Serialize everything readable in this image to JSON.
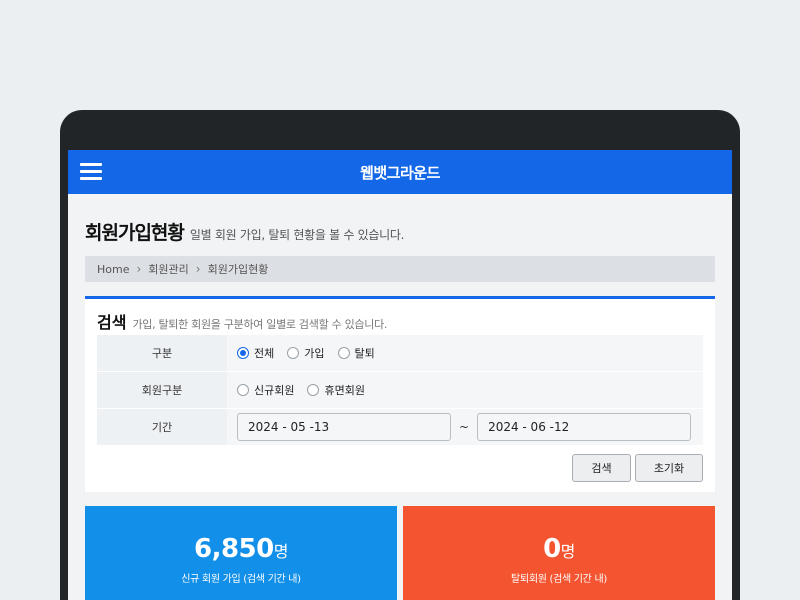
{
  "app": {
    "title": "웹뱃그라운드"
  },
  "page": {
    "title": "회원가입현황",
    "description": "일별 회원 가입, 탈퇴 현황을 볼 수 있습니다."
  },
  "breadcrumb": [
    "Home",
    "회원관리",
    "회원가입현황"
  ],
  "search": {
    "title": "검색",
    "description": "가입, 탈퇴한 회원을 구분하여 일별로 검색할 수 있습니다.",
    "rows": {
      "type": {
        "label": "구분",
        "options": [
          "전체",
          "가입",
          "탈퇴"
        ],
        "selected": "전체"
      },
      "member_type": {
        "label": "회원구분",
        "options": [
          "신규회원",
          "휴면회원"
        ],
        "selected": ""
      },
      "period": {
        "label": "기간",
        "from": "2024 - 05 -13",
        "separator": "~",
        "to": "2024 - 06 -12"
      }
    },
    "buttons": {
      "search": "검색",
      "reset": "초기화"
    }
  },
  "stats": {
    "new": {
      "value": "6,850",
      "unit": "명",
      "caption": "신규 회원 가입 (검색 기간 내)",
      "color": "#128fe8"
    },
    "withdrawn": {
      "value": "0",
      "unit": "명",
      "caption": "탈퇴회원 (검색 기간 내)",
      "color": "#f4542f"
    }
  },
  "colors": {
    "accent": "#1467e6"
  }
}
